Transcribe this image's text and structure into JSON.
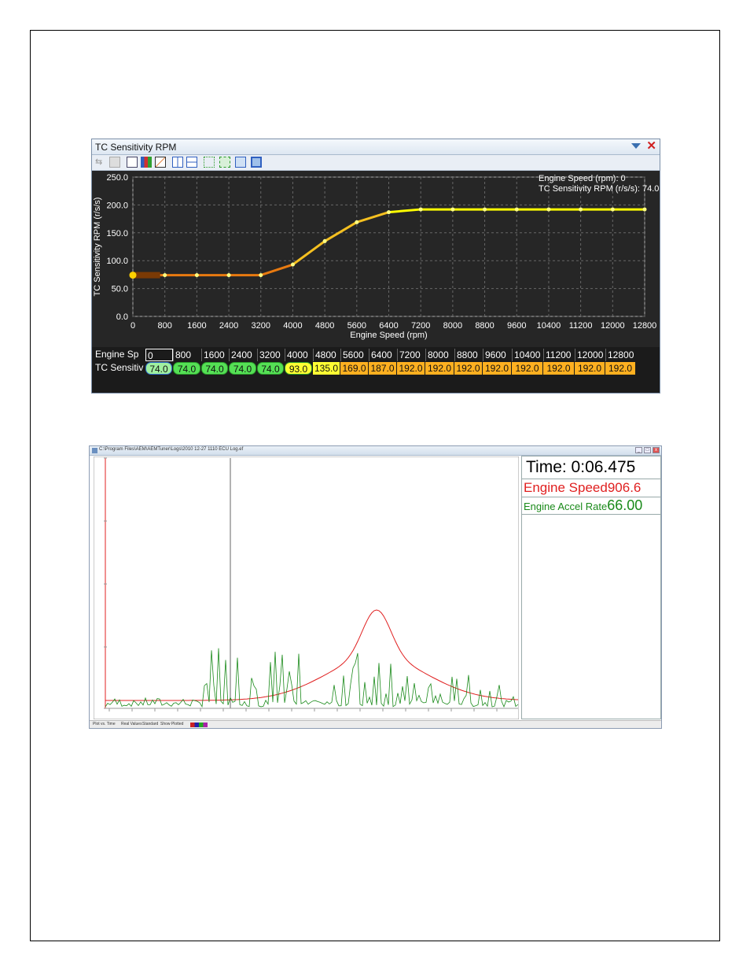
{
  "tc_window": {
    "title": "TC Sensitivity RPM",
    "readout_line1": "Engine Speed (rpm): 0",
    "readout_line2": "TC Sensitivity RPM (r/s/s): 74.0",
    "table": {
      "row1_header": "Engine Sp",
      "row2_header": "TC Sensitivi",
      "rpm": [
        "0",
        "800",
        "1600",
        "2400",
        "3200",
        "4000",
        "4800",
        "5600",
        "6400",
        "7200",
        "8000",
        "8800",
        "9600",
        "10400",
        "11200",
        "12000",
        "12800"
      ],
      "values": [
        "74.0",
        "74.0",
        "74.0",
        "74.0",
        "74.0",
        "93.0",
        "135.0",
        "169.0",
        "187.0",
        "192.0",
        "192.0",
        "192.0",
        "192.0",
        "192.0",
        "192.0",
        "192.0",
        "192.0"
      ]
    },
    "colors": {
      "green": "#55e055",
      "light_green": "#a0f0a0",
      "yellow": "#ffff33",
      "orange": "#ffb020",
      "line_low": "#e87a10",
      "line_high": "#ffff00"
    }
  },
  "chart_data": [
    {
      "type": "line",
      "title": "",
      "xlabel": "Engine Speed (rpm)",
      "ylabel": "TC Sensitivity RPM (r/s/s)",
      "x": [
        0,
        800,
        1600,
        2400,
        3200,
        4000,
        4800,
        5600,
        6400,
        7200,
        8000,
        8800,
        9600,
        10400,
        11200,
        12000,
        12800
      ],
      "xticks": [
        "0",
        "800",
        "1600",
        "2400",
        "3200",
        "4000",
        "4800",
        "5600",
        "6400",
        "7200",
        "8000",
        "8800",
        "9600",
        "10400",
        "11200",
        "12000",
        "12800"
      ],
      "yticks": [
        "0.0",
        "50.0",
        "100.0",
        "150.0",
        "200.0",
        "250.0"
      ],
      "series": [
        {
          "values": [
            74,
            74,
            74,
            74,
            74,
            93,
            135,
            169,
            187,
            192,
            192,
            192,
            192,
            192,
            192,
            192,
            192
          ]
        }
      ],
      "xlim": [
        0,
        12800
      ],
      "ylim": [
        0,
        250
      ],
      "grid": true
    }
  ],
  "log_window": {
    "title": "C:\\Program Files\\AEM\\AEMTuner\\Logs\\2010 12-27 1110 ECU Log.ef",
    "time_readout": "Time: 0:06.475",
    "engine_speed_label": "Engine Speed",
    "engine_speed_value": "906.6",
    "accel_label": "Engine Accel Rate",
    "accel_value": "66.00",
    "status_items": [
      "Plot vs. Time",
      "Real Values",
      "Standard",
      "Show Plotted"
    ],
    "colors": {
      "speed": "#e02020",
      "accel": "#1a8a1a"
    }
  }
}
